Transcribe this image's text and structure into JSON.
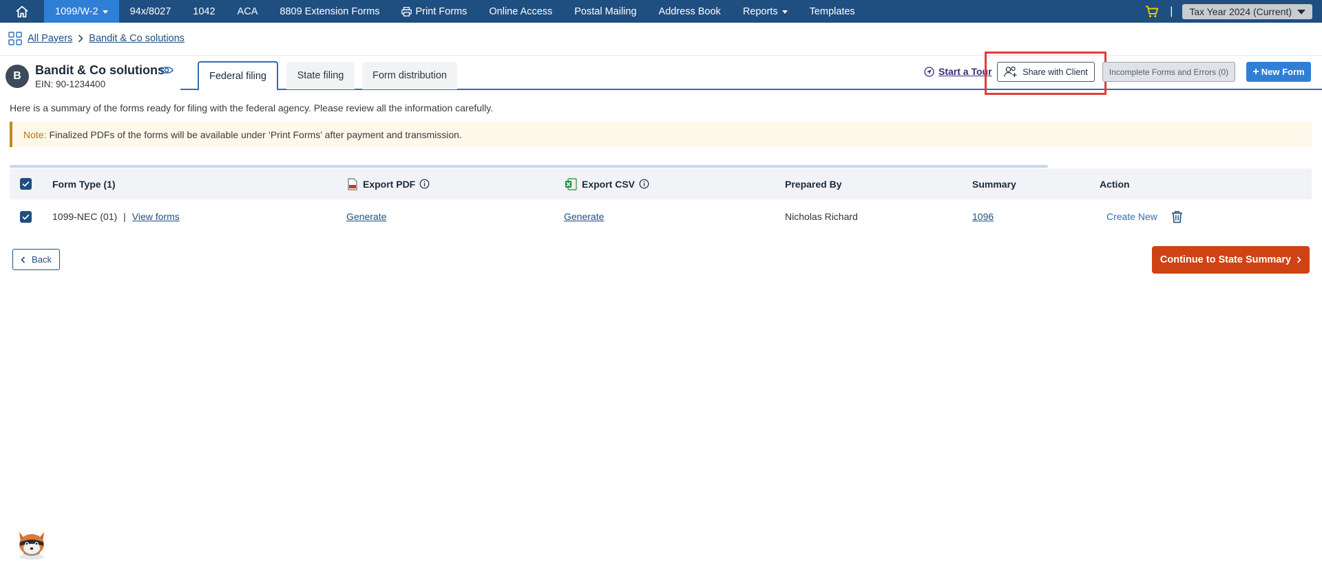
{
  "topnav": {
    "items": [
      {
        "label": "1099/W-2",
        "active": true,
        "dropdown": true
      },
      {
        "label": "94x/8027"
      },
      {
        "label": "1042"
      },
      {
        "label": "ACA"
      },
      {
        "label": "8809 Extension Forms"
      },
      {
        "label": "Print Forms",
        "icon": "printer-icon"
      },
      {
        "label": "Online Access"
      },
      {
        "label": "Postal Mailing"
      },
      {
        "label": "Address Book"
      },
      {
        "label": "Reports",
        "dropdown": true
      },
      {
        "label": "Templates"
      }
    ],
    "separator": "|",
    "tax_year": "Tax Year 2024 (Current)",
    "colors": {
      "bar": "#1f4e80",
      "active": "#2f7fd6",
      "cart": "#f5c400"
    }
  },
  "breadcrumb": {
    "all_payers": "All Payers",
    "payer": "Bandit & Co solutions"
  },
  "payer": {
    "initial": "B",
    "name": "Bandit & Co solutions",
    "ein": "EIN: 90-1234400"
  },
  "tabs": [
    {
      "label": "Federal filing",
      "active": true
    },
    {
      "label": "State filing"
    },
    {
      "label": "Form distribution"
    }
  ],
  "actions": {
    "start_tour": "Start a Tour",
    "share_with_client": "Share with Client",
    "incomplete": "Incomplete Forms and Errors (0)",
    "new_form": "New Form",
    "new_form_prefix": "+"
  },
  "summary_text": "Here is a summary of the forms ready for filing with the federal agency. Please review all the information carefully.",
  "note": {
    "label": "Note:",
    "text": "Finalized PDFs of the forms will be available under ‘Print Forms’ after payment and transmission."
  },
  "table": {
    "headers": {
      "form_type": "Form Type  (1)",
      "export_pdf": "Export PDF",
      "export_csv": "Export CSV",
      "prepared_by": "Prepared By",
      "summary": "Summary",
      "action": "Action"
    },
    "rows": [
      {
        "form_type": "1099-NEC (01)",
        "divider": "|",
        "view_forms": "View forms",
        "export_pdf": "Generate",
        "export_csv": "Generate",
        "prepared_by": "Nicholas Richard",
        "summary": "1096",
        "action": "Create New",
        "checked": true
      }
    ],
    "header_checked": true
  },
  "footer": {
    "back": "Back",
    "continue": "Continue to State Summary"
  }
}
